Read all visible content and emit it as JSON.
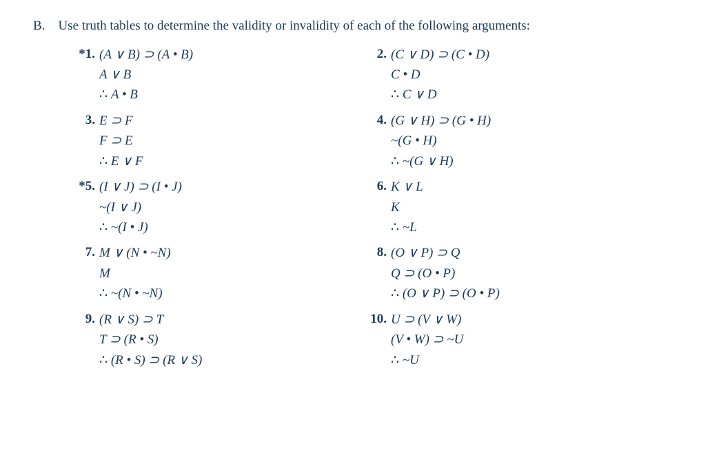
{
  "intro": {
    "label": "B.",
    "text": "Use truth tables to determine the validity or invalidity of each of the following arguments:"
  },
  "problems": [
    {
      "left": {
        "number": "*1.",
        "premises": [
          "(A ∨ B) ⊃ (A • B)",
          "A ∨ B"
        ],
        "conclusion": "A • B"
      },
      "right": {
        "number": "2.",
        "premises": [
          "(C ∨ D) ⊃ (C • D)",
          "C • D"
        ],
        "conclusion": "C ∨ D"
      }
    },
    {
      "left": {
        "number": "3.",
        "premises": [
          "E ⊃ F",
          "F ⊃ E"
        ],
        "conclusion": "E ∨ F"
      },
      "right": {
        "number": "4.",
        "premises": [
          "(G ∨ H) ⊃ (G • H)",
          "~(G • H)"
        ],
        "conclusion": "~(G ∨ H)"
      }
    },
    {
      "left": {
        "number": "*5.",
        "premises": [
          "(I ∨ J) ⊃ (I • J)",
          "~(I ∨ J)"
        ],
        "conclusion": "~(I • J)"
      },
      "right": {
        "number": "6.",
        "premises": [
          "K ∨ L",
          "K"
        ],
        "conclusion": "~L"
      }
    },
    {
      "left": {
        "number": "7.",
        "premises": [
          "M ∨ (N • ~N)",
          "M"
        ],
        "conclusion": "~(N • ~N)"
      },
      "right": {
        "number": "8.",
        "premises": [
          "(O ∨ P) ⊃ Q",
          "Q ⊃ (O • P)"
        ],
        "conclusion": "(O ∨ P) ⊃ (O • P)"
      }
    },
    {
      "left": {
        "number": "9.",
        "premises": [
          "(R ∨ S) ⊃ T",
          "T ⊃ (R • S)"
        ],
        "conclusion": "(R • S) ⊃ (R ∨ S)"
      },
      "right": {
        "number": "10.",
        "premises": [
          "U ⊃ (V ∨ W)",
          "(V • W) ⊃ ~U"
        ],
        "conclusion": "~U"
      }
    }
  ]
}
